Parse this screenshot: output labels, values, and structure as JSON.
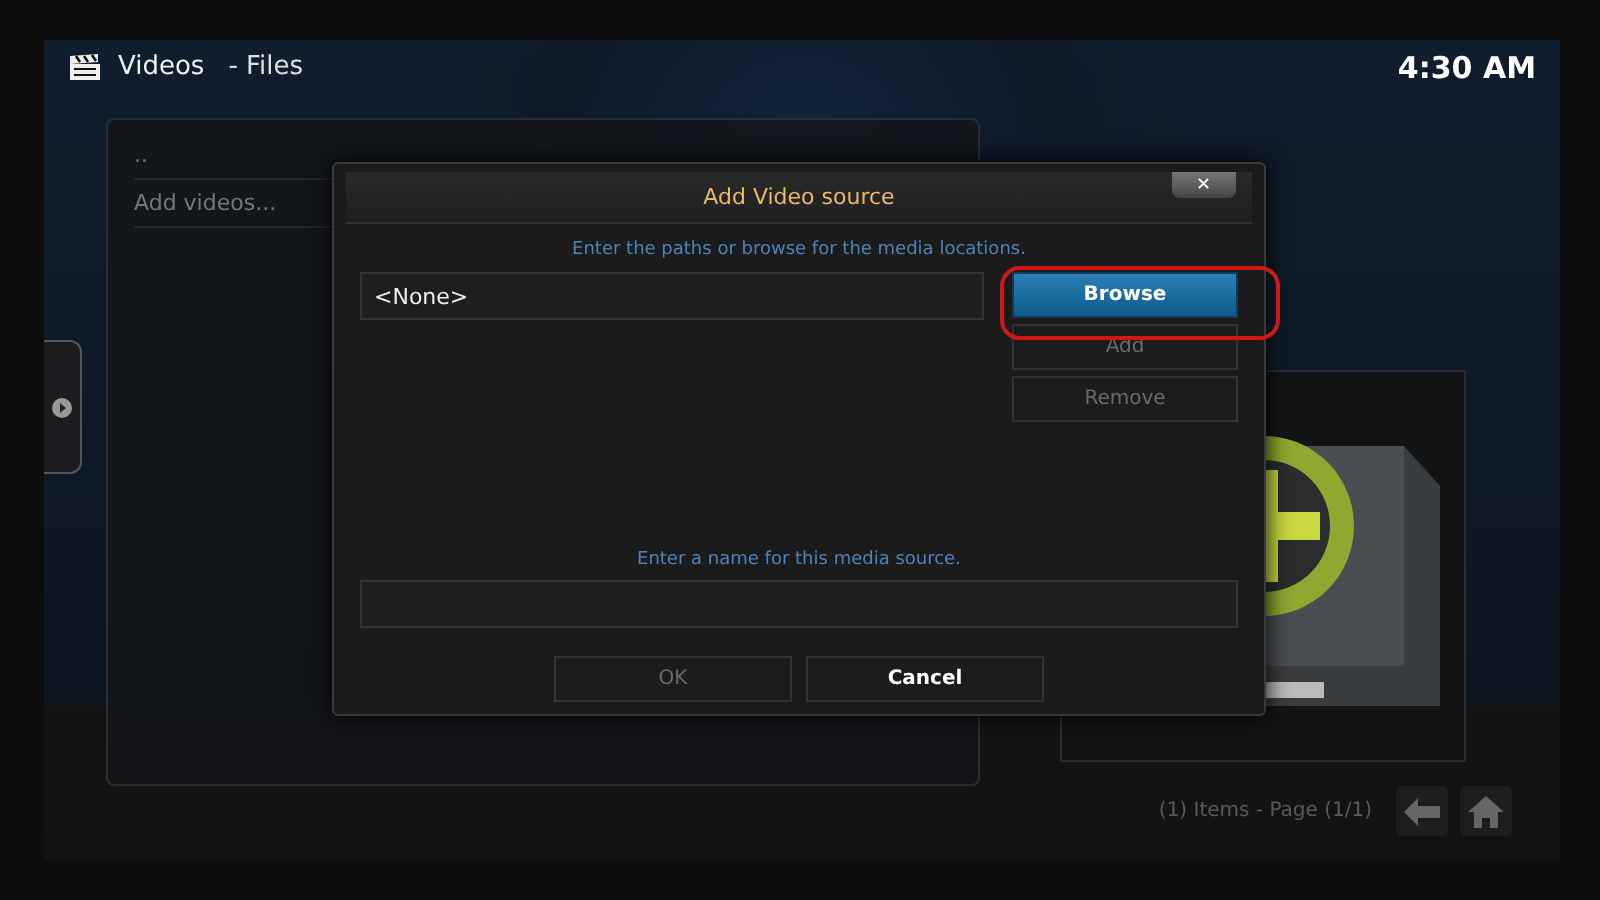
{
  "header": {
    "section": "Videos",
    "subsection": "- Files",
    "clock": "4:30 AM"
  },
  "list": {
    "items": [
      {
        "label": ".."
      },
      {
        "label": "Add videos..."
      }
    ]
  },
  "dialog": {
    "title": "Add Video source",
    "close": "✕",
    "paths_hint": "Enter the paths or browse for the media locations.",
    "path_value": "<None>",
    "name_hint": "Enter a name for this media source.",
    "side_buttons": [
      {
        "label": "Browse",
        "focused": true,
        "disabled": false
      },
      {
        "label": "Add",
        "focused": false,
        "disabled": true
      },
      {
        "label": "Remove",
        "focused": false,
        "disabled": true
      }
    ],
    "bottom_buttons": [
      {
        "label": "OK",
        "focused": false,
        "disabled": true
      },
      {
        "label": "Cancel",
        "focused": false,
        "disabled": false
      }
    ],
    "highlight": true
  },
  "footer": {
    "status": "(1) Items - Page (1/1)"
  }
}
